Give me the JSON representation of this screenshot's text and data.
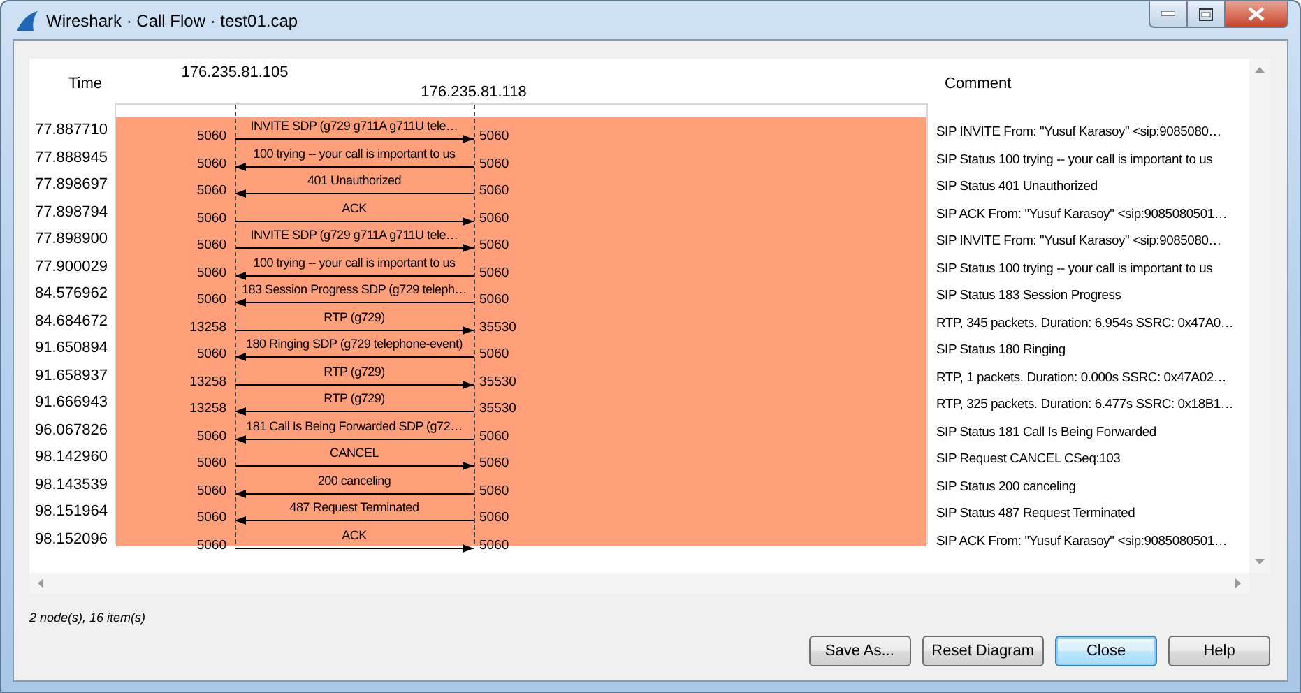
{
  "window": {
    "title": "Wireshark · Call Flow · test01.cap"
  },
  "diagram": {
    "time_header": "Time",
    "comment_header": "Comment",
    "nodes": [
      "176.235.81.105",
      "176.235.81.118"
    ],
    "rows": [
      {
        "time": "77.887710",
        "left_port": "5060",
        "right_port": "5060",
        "label": "INVITE SDP (g729 g711A g711U tele…",
        "rightward": true,
        "comment": "SIP INVITE From: \"Yusuf Karasoy\" <sip:9085080…"
      },
      {
        "time": "77.888945",
        "left_port": "5060",
        "right_port": "5060",
        "label": "100 trying -- your call is important to us",
        "rightward": false,
        "comment": "SIP Status 100 trying -- your call is important to us"
      },
      {
        "time": "77.898697",
        "left_port": "5060",
        "right_port": "5060",
        "label": "401 Unauthorized",
        "rightward": false,
        "comment": "SIP Status 401 Unauthorized"
      },
      {
        "time": "77.898794",
        "left_port": "5060",
        "right_port": "5060",
        "label": "ACK",
        "rightward": true,
        "comment": "SIP ACK From: \"Yusuf Karasoy\" <sip:9085080501…"
      },
      {
        "time": "77.898900",
        "left_port": "5060",
        "right_port": "5060",
        "label": "INVITE SDP (g729 g711A g711U tele…",
        "rightward": true,
        "comment": "SIP INVITE From: \"Yusuf Karasoy\" <sip:9085080…"
      },
      {
        "time": "77.900029",
        "left_port": "5060",
        "right_port": "5060",
        "label": "100 trying -- your call is important to us",
        "rightward": false,
        "comment": "SIP Status 100 trying -- your call is important to us"
      },
      {
        "time": "84.576962",
        "left_port": "5060",
        "right_port": "5060",
        "label": "183 Session Progress SDP (g729 teleph…",
        "rightward": false,
        "comment": "SIP Status 183 Session Progress"
      },
      {
        "time": "84.684672",
        "left_port": "13258",
        "right_port": "35530",
        "label": "RTP (g729)",
        "rightward": true,
        "comment": "RTP, 345 packets. Duration: 6.954s SSRC: 0x47A0…"
      },
      {
        "time": "91.650894",
        "left_port": "5060",
        "right_port": "5060",
        "label": "180 Ringing SDP (g729 telephone-event)",
        "rightward": false,
        "comment": "SIP Status 180 Ringing"
      },
      {
        "time": "91.658937",
        "left_port": "13258",
        "right_port": "35530",
        "label": "RTP (g729)",
        "rightward": true,
        "comment": "RTP, 1 packets. Duration: 0.000s SSRC: 0x47A02…"
      },
      {
        "time": "91.666943",
        "left_port": "13258",
        "right_port": "35530",
        "label": "RTP (g729)",
        "rightward": false,
        "comment": "RTP, 325 packets. Duration: 6.477s SSRC: 0x18B1…"
      },
      {
        "time": "96.067826",
        "left_port": "5060",
        "right_port": "5060",
        "label": "181 Call Is Being Forwarded SDP (g72…",
        "rightward": false,
        "comment": "SIP Status 181 Call Is Being Forwarded"
      },
      {
        "time": "98.142960",
        "left_port": "5060",
        "right_port": "5060",
        "label": "CANCEL",
        "rightward": true,
        "comment": "SIP Request CANCEL CSeq:103"
      },
      {
        "time": "98.143539",
        "left_port": "5060",
        "right_port": "5060",
        "label": "200 canceling",
        "rightward": false,
        "comment": "SIP Status 200 canceling"
      },
      {
        "time": "98.151964",
        "left_port": "5060",
        "right_port": "5060",
        "label": "487 Request Terminated",
        "rightward": false,
        "comment": "SIP Status 487 Request Terminated"
      },
      {
        "time": "98.152096",
        "left_port": "5060",
        "right_port": "5060",
        "label": "ACK",
        "rightward": true,
        "comment": "SIP ACK From: \"Yusuf Karasoy\" <sip:9085080501…"
      }
    ]
  },
  "status": "2 node(s), 16 item(s)",
  "buttons": [
    {
      "label": "Save As...",
      "focused": false
    },
    {
      "label": "Reset Diagram",
      "focused": false
    },
    {
      "label": "Close",
      "focused": true
    },
    {
      "label": "Help",
      "focused": false
    }
  ]
}
